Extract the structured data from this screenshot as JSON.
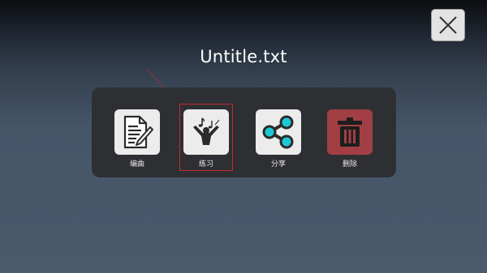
{
  "header": {
    "title": "Untitle.txt"
  },
  "actions": [
    {
      "label": "编曲",
      "icon": "edit-document-icon"
    },
    {
      "label": "练习",
      "icon": "practice-conductor-icon"
    },
    {
      "label": "分享",
      "icon": "share-icon"
    },
    {
      "label": "删除",
      "icon": "trash-icon"
    }
  ],
  "colors": {
    "delete_tile": "#a23f44",
    "highlight": "#c42a2a",
    "share_nodes": "#1ec8d4"
  }
}
